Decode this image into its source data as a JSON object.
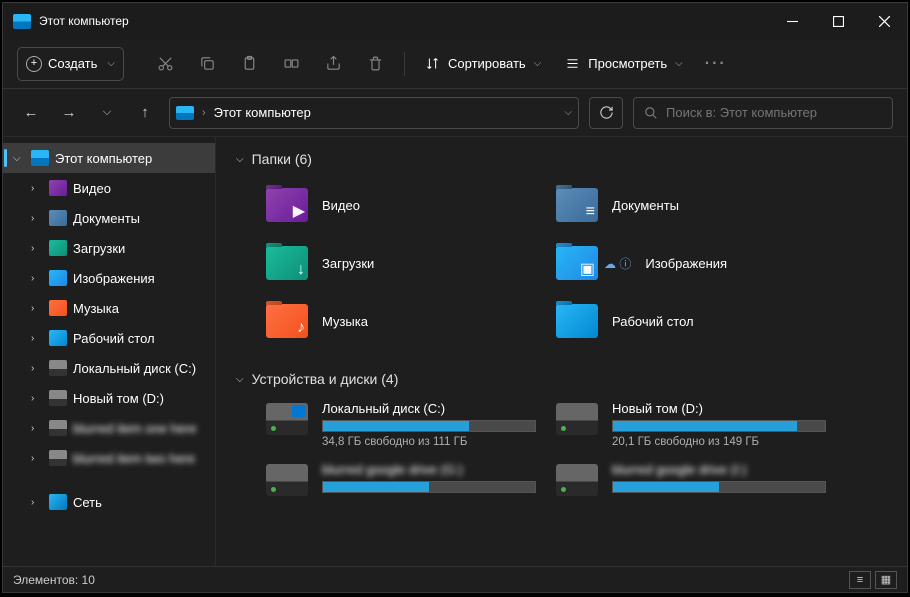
{
  "title": "Этот компьютер",
  "toolbar": {
    "new": "Создать",
    "sort": "Сортировать",
    "view": "Просмотреть"
  },
  "nav": {
    "location": "Этот компьютер"
  },
  "search": {
    "placeholder": "Поиск в: Этот компьютер"
  },
  "sidebar": {
    "root": "Этот компьютер",
    "items": [
      {
        "label": "Видео",
        "cls": "iconVideo"
      },
      {
        "label": "Документы",
        "cls": "iconDoc"
      },
      {
        "label": "Загрузки",
        "cls": "iconDl"
      },
      {
        "label": "Изображения",
        "cls": "iconImg"
      },
      {
        "label": "Музыка",
        "cls": "iconMusic"
      },
      {
        "label": "Рабочий стол",
        "cls": "iconDesk"
      },
      {
        "label": "Локальный диск (C:)",
        "cls": "iconDrive"
      },
      {
        "label": "Новый том (D:)",
        "cls": "iconDrive"
      },
      {
        "label": "blurred item one here",
        "cls": "iconDrive",
        "blur": true
      },
      {
        "label": "blurred item two here",
        "cls": "iconDrive",
        "blur": true
      }
    ],
    "network": "Сеть"
  },
  "groups": {
    "folders": {
      "title": "Папки (6)",
      "items": [
        {
          "label": "Видео",
          "cls": "iconVideo",
          "ovl": "▶"
        },
        {
          "label": "Документы",
          "cls": "iconDoc",
          "ovl": "≡"
        },
        {
          "label": "Загрузки",
          "cls": "iconDl",
          "ovl": "↓"
        },
        {
          "label": "Изображения",
          "cls": "iconImg",
          "ovl": "▣",
          "badge": true
        },
        {
          "label": "Музыка",
          "cls": "iconMusic",
          "ovl": "♪"
        },
        {
          "label": "Рабочий стол",
          "cls": "iconDesk",
          "ovl": ""
        }
      ]
    },
    "drives": {
      "title": "Устройства и диски (4)",
      "items": [
        {
          "name": "Локальный диск (C:)",
          "stat": "34,8 ГБ свободно из 111 ГБ",
          "pct": 69,
          "win": true
        },
        {
          "name": "Новый том (D:)",
          "stat": "20,1 ГБ свободно из 149 ГБ",
          "pct": 87
        },
        {
          "name": "blurred google drive (G:)",
          "stat": "",
          "pct": 50,
          "blur": true,
          "short": "(G:)"
        },
        {
          "name": "blurred google drive (I:)",
          "stat": "",
          "pct": 50,
          "blur": true,
          "short": "(I:)"
        }
      ]
    }
  },
  "status": {
    "count": "Элементов: 10"
  }
}
